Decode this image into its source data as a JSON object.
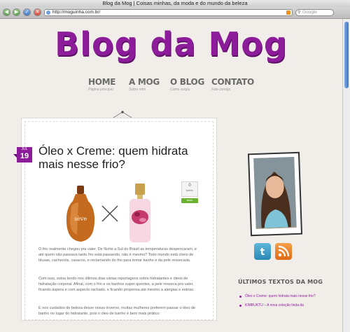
{
  "window": {
    "title": "Blog da Mog | Coisas minhas, da moda e do mundo da beleza"
  },
  "toolbar": {
    "url": "http://moguinha.com.br/",
    "search_placeholder": "Google"
  },
  "site": {
    "logo": "Blog da Mog",
    "accent_color": "#8d1c9a",
    "menu": [
      {
        "label": "HOME",
        "sub": "Página principal"
      },
      {
        "label": "A MOG",
        "sub": "Sobre mim"
      },
      {
        "label": "O BLOG",
        "sub": "Como surgiu"
      },
      {
        "label": "CONTATO",
        "sub": "Fale comigo"
      }
    ]
  },
  "post": {
    "date_month": "JUL",
    "date_day": "19",
    "title": "Óleo x Creme: quem hidrata mais nesse frio?",
    "share_count": "0",
    "share_label": "tweets",
    "tweet_label": "tweet",
    "bottle_label": "sève",
    "paragraphs": [
      "O frio realmente chegou pra valer. De Norte a Sul do Brasil as temperaturas despencaram, e até quem não passava tanto frio está passando, não é mesmo? Todo mundo está cheio de blusas, cachecóis, casacos, e reclamando do frio para tomar banho e da pele ressecada.",
      "Com isso, estou lendo nos últimos dias várias reportagens sobre hidratantes e óleos de hidratação corporal. Afinal, com o frio e os banhos super quentes, a pele resseca pra valer, ficando áspera e com aspecto rachado, e ficando propensa até mesmo a alergias e estrias.",
      "E nos cuidados de beleza desse nosso inverno, muitas mulheres preferem passar o óleo de banho no lugar do hidratante, pois o óleo de banho é bem mais prático:"
    ]
  },
  "sidebar": {
    "heading": "ÚLTIMOS TEXTOS DA MOG",
    "recent": [
      "Óleo x Creme: quem hidrata mais nesse frio?",
      "KIMBUKTU – A nova coleção linda da"
    ]
  }
}
